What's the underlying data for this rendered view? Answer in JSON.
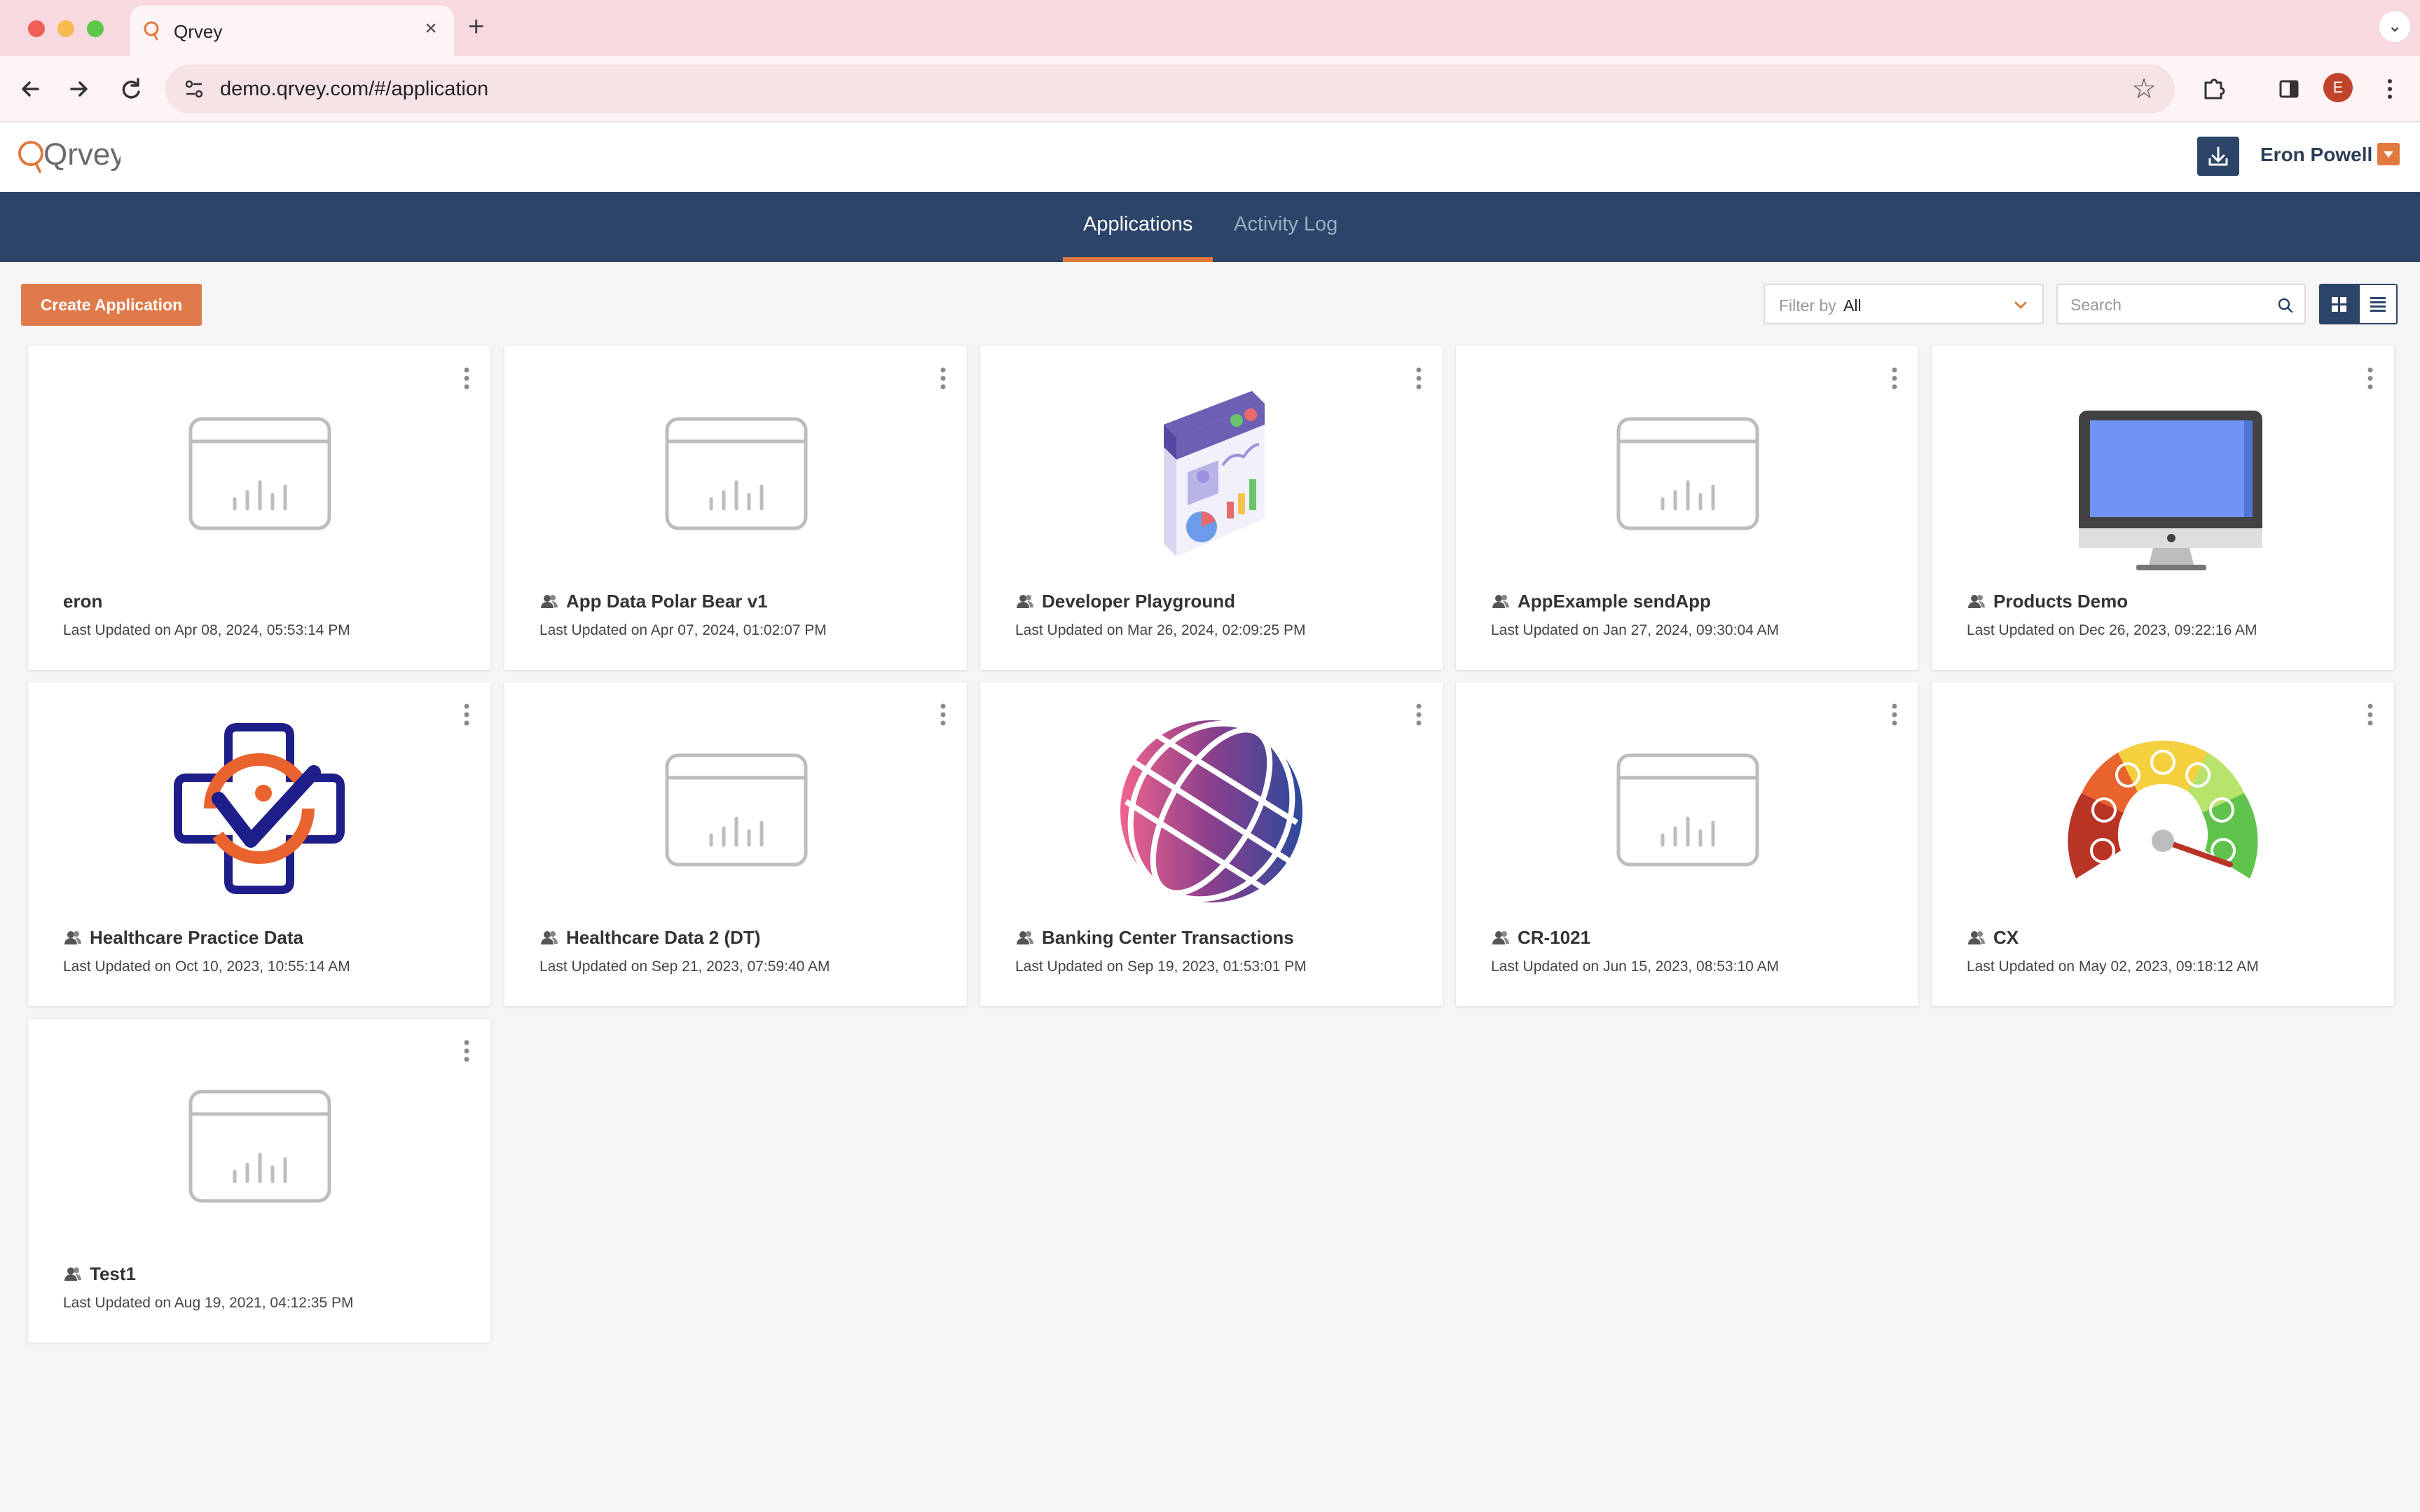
{
  "browser": {
    "tab_title": "Qrvey",
    "url": "demo.qrvey.com/#/application",
    "profile_initial": "E",
    "traffic_colors": [
      "#ee5f57",
      "#f5bd4f",
      "#5fc84b"
    ]
  },
  "header": {
    "logo_text": "Qrvey",
    "user_name": "Eron Powell"
  },
  "nav": {
    "tabs": [
      {
        "label": "Applications",
        "active": true
      },
      {
        "label": "Activity Log",
        "active": false
      }
    ]
  },
  "actions": {
    "create_label": "Create Application",
    "filter_label": "Filter by",
    "filter_value": "All",
    "search_placeholder": "Search"
  },
  "colors": {
    "brand_navy": "#2c4468",
    "accent_orange": "#e07a4a"
  },
  "apps": [
    {
      "name": "eron",
      "updated": "Last Updated on Apr 08, 2024, 05:53:14 PM",
      "thumb": "placeholder-chart-icon",
      "shared": false
    },
    {
      "name": "App Data Polar Bear v1",
      "updated": "Last Updated on Apr 07, 2024, 01:02:07 PM",
      "thumb": "placeholder-chart-icon",
      "shared": true
    },
    {
      "name": "Developer Playground",
      "updated": "Last Updated on Mar 26, 2024, 02:09:25 PM",
      "thumb": "dashboard-illustration",
      "shared": true
    },
    {
      "name": "AppExample sendApp",
      "updated": "Last Updated on Jan 27, 2024, 09:30:04 AM",
      "thumb": "placeholder-chart-icon",
      "shared": true
    },
    {
      "name": "Products Demo",
      "updated": "Last Updated on Dec 26, 2023, 09:22:16 AM",
      "thumb": "monitor-illustration",
      "shared": true
    },
    {
      "name": "Healthcare Practice Data",
      "updated": "Last Updated on Oct 10, 2023, 10:55:14 AM",
      "thumb": "medical-cross-logo",
      "shared": true
    },
    {
      "name": "Healthcare Data 2 (DT)",
      "updated": "Last Updated on Sep 21, 2023, 07:59:40 AM",
      "thumb": "placeholder-chart-icon",
      "shared": true
    },
    {
      "name": "Banking Center Transactions",
      "updated": "Last Updated on Sep 19, 2023, 01:53:01 PM",
      "thumb": "globe-illustration",
      "shared": true
    },
    {
      "name": "CR-1021",
      "updated": "Last Updated on Jun 15, 2023, 08:53:10 AM",
      "thumb": "placeholder-chart-icon",
      "shared": true
    },
    {
      "name": "CX",
      "updated": "Last Updated on May 02, 2023, 09:18:12 AM",
      "thumb": "satisfaction-gauge",
      "shared": true
    },
    {
      "name": "Test1",
      "updated": "Last Updated on Aug 19, 2021, 04:12:35 PM",
      "thumb": "placeholder-chart-icon",
      "shared": true
    }
  ]
}
